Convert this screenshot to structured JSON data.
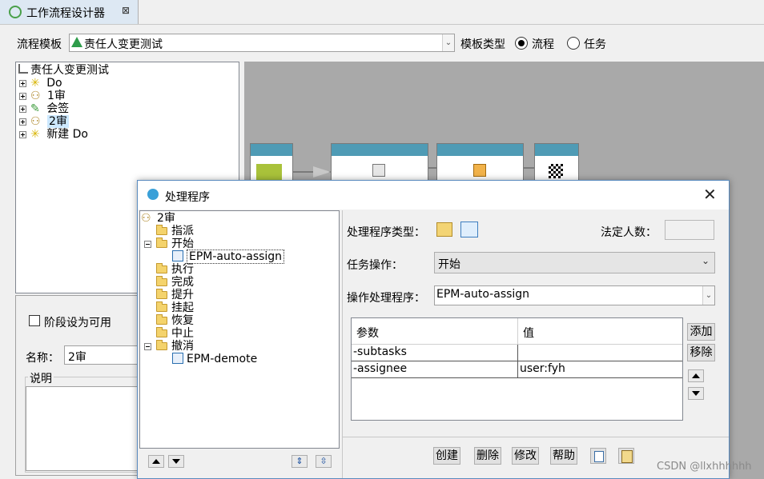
{
  "tab": {
    "title": "工作流程设计器",
    "close": "⊠"
  },
  "toolbar": {
    "template_label": "流程模板",
    "template_value": "责任人变更测试",
    "type_label": "模板类型",
    "radio_process": "流程",
    "radio_task": "任务",
    "selected_type": "流程"
  },
  "tree": {
    "root": "责任人变更测试",
    "items": [
      "Do",
      "1审",
      "会签",
      "2审",
      "新建 Do"
    ],
    "selected": "2审"
  },
  "props": {
    "stage_available": "阶段设为可用",
    "name_label": "名称：",
    "name_value": "2审",
    "desc_label": "说明"
  },
  "dialog": {
    "title": "处理程序",
    "tree_root": "2审",
    "tree_items": [
      "指派",
      "开始",
      "EPM-auto-assign",
      "执行",
      "完成",
      "提升",
      "挂起",
      "恢复",
      "中止",
      "撤消",
      "EPM-demote"
    ],
    "handler_type_label": "处理程序类型：",
    "legal_count_label": "法定人数：",
    "legal_count_value": "",
    "task_action_label": "任务操作：",
    "task_action_value": "开始",
    "action_handler_label": "操作处理程序：",
    "action_handler_value": "EPM-auto-assign",
    "table": {
      "headers": [
        "参数",
        "值"
      ],
      "rows": [
        [
          "-subtasks",
          ""
        ],
        [
          "-assignee",
          "user:fyh"
        ]
      ]
    },
    "add_label": "添加",
    "remove_label": "移除",
    "buttons": [
      "创建",
      "删除",
      "修改",
      "帮助"
    ]
  },
  "watermark": "CSDN @llxhhhhhh",
  "colors": {
    "accent": "#4f9bb5",
    "selection": "#cce8ff",
    "canvas": "#a9a9a9"
  }
}
